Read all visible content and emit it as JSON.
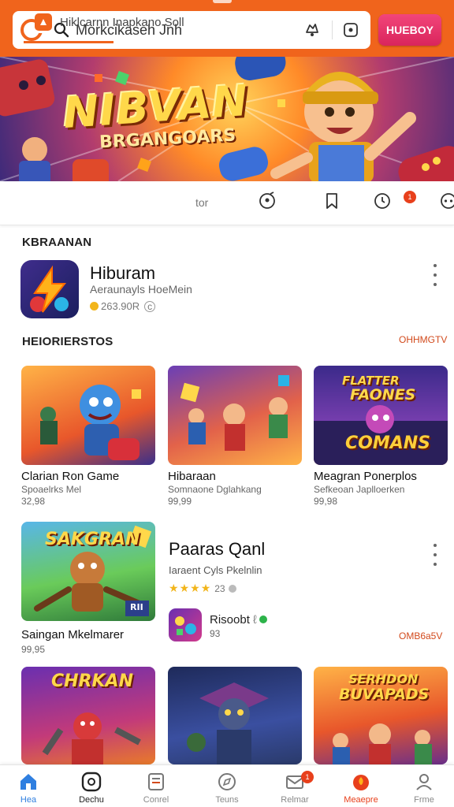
{
  "header": {
    "search_text": "Morkcikaseh Jnh",
    "action_button": "HUEBOY"
  },
  "banner": {
    "title": "NIBVAN",
    "subtitle": "BRGANGOARS"
  },
  "tabs": {
    "active_label": "Hiklcarnn Inapkano Soll",
    "second_label": "tor",
    "notification_badge": "1"
  },
  "section1": {
    "label": "KBRAANAN"
  },
  "featured_app": {
    "title": "Hiburam",
    "subtitle": "Aeraunayls HoeMein",
    "meta": "263.90R"
  },
  "section2": {
    "label": "HEIORIERSTOS",
    "see_all": "OHHMGTV"
  },
  "cards_row1": [
    {
      "title": "Clarian Ron Game",
      "sub": "Spoaelrks Mel",
      "price": "32,98"
    },
    {
      "title": "Hibaraan",
      "sub": "Somnaone Dglahkang",
      "price": "99,99"
    },
    {
      "title": "Meagran Ponerplos",
      "sub": "Sefkeoan Japlloerken",
      "price": "99,98",
      "img_text_1": "FLATTER",
      "img_text_2": "FAONES",
      "img_text_3": "COMANS"
    }
  ],
  "card_row2": {
    "title": "Saingan Mkelmarer",
    "price": "99,95",
    "img_text": "SAKGRAN",
    "img_tag": "RII"
  },
  "feature2": {
    "title": "Paaras Qanl",
    "subtitle": "Iaraent Cyls Pkelnlin",
    "rating": "23",
    "mini_title": "Risoobt",
    "mini_num": "93",
    "see_all": "OMB6a5V"
  },
  "cards_row3": [
    {
      "img_text_1": "CHRKAN"
    },
    {
      "img_text_1": ""
    },
    {
      "img_text_1": "SERHDON",
      "img_text_2": "BUVAPADS"
    }
  ],
  "bottom_nav": [
    {
      "label": "Hea",
      "icon": "home-icon",
      "active": true
    },
    {
      "label": "Dechu",
      "icon": "chat-icon"
    },
    {
      "label": "Conrel",
      "icon": "document-icon"
    },
    {
      "label": "Teuns",
      "icon": "compass-icon"
    },
    {
      "label": "Relmar",
      "icon": "mail-icon",
      "badge": "1"
    },
    {
      "label": "Meaepre",
      "icon": "fire-icon"
    },
    {
      "label": "Frme",
      "icon": "profile-icon"
    }
  ],
  "colors": {
    "brand_orange": "#f0641c",
    "accent_pink": "#e23768"
  }
}
